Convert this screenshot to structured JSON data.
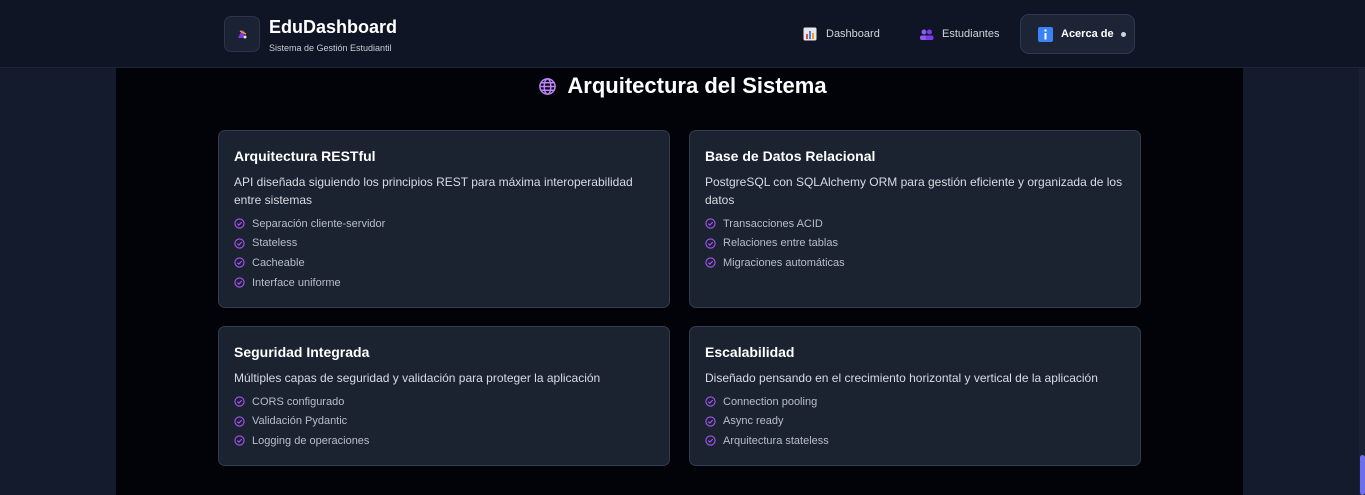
{
  "header": {
    "brand_title": "EduDashboard",
    "brand_subtitle": "Sistema de Gestión Estudiantil",
    "nav": [
      {
        "label": "Dashboard",
        "icon": "bar-chart-icon"
      },
      {
        "label": "Estudiantes",
        "icon": "users-icon"
      },
      {
        "label": "Acerca de",
        "icon": "info-icon",
        "active": true
      }
    ]
  },
  "section": {
    "title": "Arquitectura del Sistema",
    "icon": "globe-icon"
  },
  "cards": [
    {
      "title": "Arquitectura RESTful",
      "description": "API diseñada siguiendo los principios REST para máxima interoperabilidad entre sistemas",
      "items": [
        "Separación cliente-servidor",
        "Stateless",
        "Cacheable",
        "Interface uniforme"
      ]
    },
    {
      "title": "Base de Datos Relacional",
      "description": "PostgreSQL con SQLAlchemy ORM para gestión eficiente y organizada de los datos",
      "items": [
        "Transacciones ACID",
        "Relaciones entre tablas",
        "Migraciones automáticas"
      ]
    },
    {
      "title": "Seguridad Integrada",
      "description": "Múltiples capas de seguridad y validación para proteger la aplicación",
      "items": [
        "CORS configurado",
        "Validación Pydantic",
        "Logging de operaciones"
      ]
    },
    {
      "title": "Escalabilidad",
      "description": "Diseñado pensando en el crecimiento horizontal y vertical de la aplicación",
      "items": [
        "Connection pooling",
        "Async ready",
        "Arquitectura stateless"
      ]
    }
  ],
  "colors": {
    "accent": "#a855f7",
    "card_bg": "#1b2230",
    "page_bg": "#020308"
  }
}
